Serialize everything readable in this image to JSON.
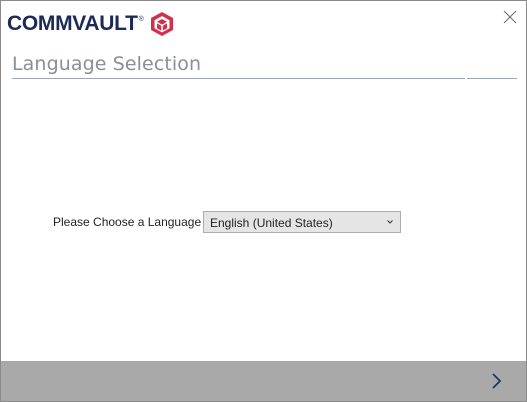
{
  "brand": {
    "name": "COMMVAULT",
    "trademark": "®",
    "text_color": "#1d2a55",
    "mark_color": "#d1314b"
  },
  "window": {
    "close_icon": "close-icon"
  },
  "header": {
    "title": "Language Selection"
  },
  "form": {
    "language_label": "Please Choose a Language",
    "language_value": "English (United States)",
    "dropdown_icon": "chevron-down-icon"
  },
  "footer": {
    "background": "#a9a9a9",
    "next_icon": "chevron-right-icon"
  }
}
